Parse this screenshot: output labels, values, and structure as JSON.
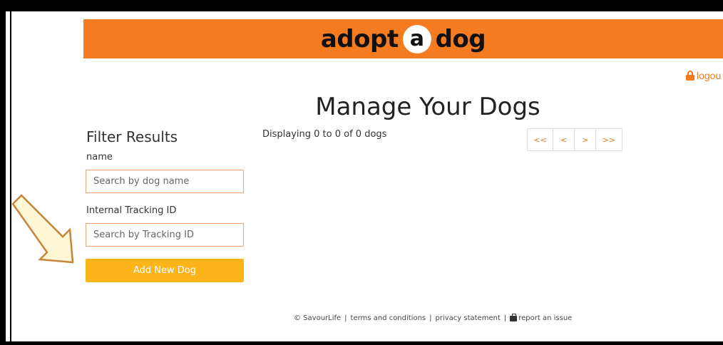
{
  "header": {
    "logo": {
      "word1": "adopt",
      "middle": "a",
      "word2": "dog"
    },
    "brand_color": "#f47b20"
  },
  "logout": {
    "label": "logou",
    "icon": "lock-icon"
  },
  "main": {
    "title": "Manage Your Dogs",
    "displaying": "Displaying 0 to 0 of 0 dogs"
  },
  "filters": {
    "heading": "Filter Results",
    "name_label": "name",
    "name_placeholder": "Search by dog name",
    "tracking_label": "Internal Tracking ID",
    "tracking_placeholder": "Search by Tracking ID",
    "add_button": "Add New Dog",
    "add_button_color": "#fbb51b"
  },
  "pager": {
    "first": "<<",
    "prev": "<",
    "next": ">",
    "last": ">>"
  },
  "footer": {
    "copyright": "© SavourLife",
    "terms": "terms and conditions",
    "privacy": "privacy statement",
    "report": "report an issue",
    "separator": "|"
  }
}
